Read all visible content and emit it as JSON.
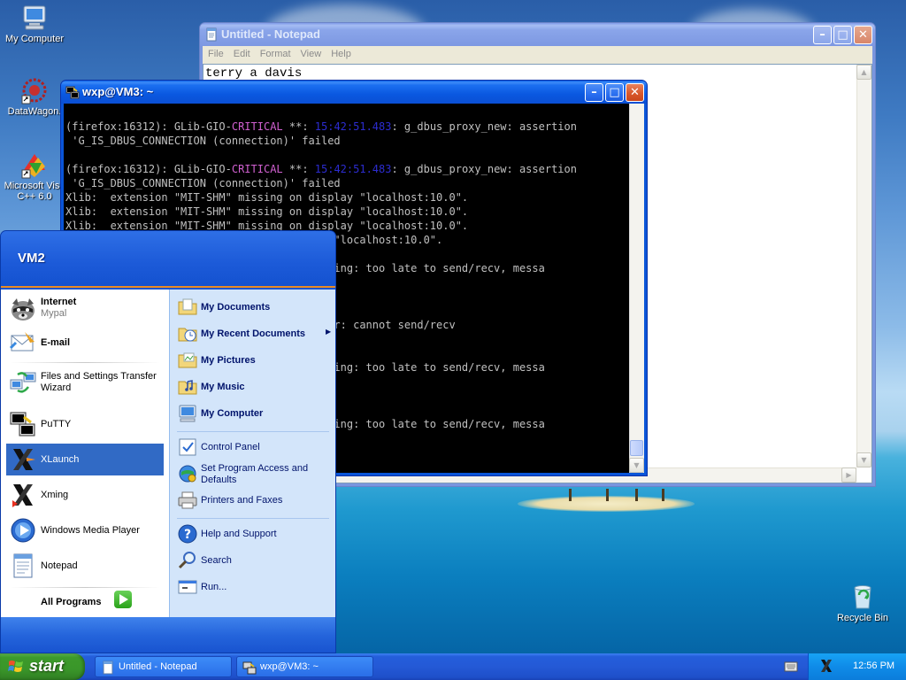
{
  "desktop": {
    "icons": [
      {
        "label": "My Computer"
      },
      {
        "label": "DataWagon."
      },
      {
        "label": "Microsoft Visu",
        "label2": "C++ 6.0"
      },
      {
        "label": "Recycle Bin"
      }
    ]
  },
  "notepad": {
    "title": "Untitled - Notepad",
    "menu": [
      "File",
      "Edit",
      "Format",
      "View",
      "Help"
    ],
    "content": "terry a davis"
  },
  "putty": {
    "title": "wxp@VM3: ~",
    "lines": [
      {
        "pre": "(firefox:16312): GLib-GIO-",
        "crit": "CRITICAL",
        "mid": " **: ",
        "ts": "15:42:51.483",
        "post": ": g_dbus_proxy_new: assertion"
      },
      {
        "text": " 'G_IS_DBUS_CONNECTION (connection)' failed"
      },
      {
        "text": ""
      },
      {
        "pre": "(firefox:16312): GLib-GIO-",
        "crit": "CRITICAL",
        "mid": " **: ",
        "ts": "15:42:51.483",
        "post": ": g_dbus_proxy_new: assertion"
      },
      {
        "text": " 'G_IS_DBUS_CONNECTION (connection)' failed"
      },
      {
        "text": "Xlib:  extension \"MIT-SHM\" missing on display \"localhost:10.0\"."
      },
      {
        "text": "Xlib:  extension \"MIT-SHM\" missing on display \"localhost:10.0\"."
      },
      {
        "text": "Xlib:  extension \"MIT-SHM\" missing on display \"localhost:10.0\"."
      },
      {
        "text": "                                  display \"localhost:10.0\"."
      },
      {
        "text": ""
      },
      {
        "text": "                                  nel closing: too late to send/recv, messa"
      },
      {
        "text": ""
      },
      {
        "text": ""
      },
      {
        "text": ""
      },
      {
        "text": "                                  nel error: cannot send/recv"
      },
      {
        "text": ""
      },
      {
        "text": ""
      },
      {
        "text": "                                  nel closing: too late to send/recv, messa"
      },
      {
        "text": ""
      },
      {
        "text": ""
      },
      {
        "text": ""
      },
      {
        "text": "                                  nel closing: too late to send/recv, messa"
      }
    ]
  },
  "startmenu": {
    "user": "VM2",
    "pinned": [
      {
        "title": "Internet",
        "sub": "Mypal"
      },
      {
        "title": "E-mail",
        "sub": ""
      }
    ],
    "recent": [
      {
        "line1": "Files and Settings Transfer",
        "line2": "Wizard"
      },
      {
        "line1": "PuTTY"
      },
      {
        "line1": "XLaunch"
      },
      {
        "line1": "Xming"
      },
      {
        "line1": "Windows Media Player"
      },
      {
        "line1": "Notepad"
      }
    ],
    "all_programs": "All Programs",
    "right": {
      "docs": "My Documents",
      "recent_docs": "My Recent Documents",
      "pictures": "My Pictures",
      "music": "My Music",
      "computer": "My Computer",
      "control_panel": "Control Panel",
      "spad_1": "Set Program Access and",
      "spad_2": "Defaults",
      "printers": "Printers and Faxes",
      "help": "Help and Support",
      "search": "Search",
      "run": "Run..."
    }
  },
  "taskbar": {
    "start": "start",
    "tasks": [
      {
        "label": "Untitled - Notepad"
      },
      {
        "label": "wxp@VM3: ~"
      }
    ],
    "clock": "12:56 PM"
  }
}
